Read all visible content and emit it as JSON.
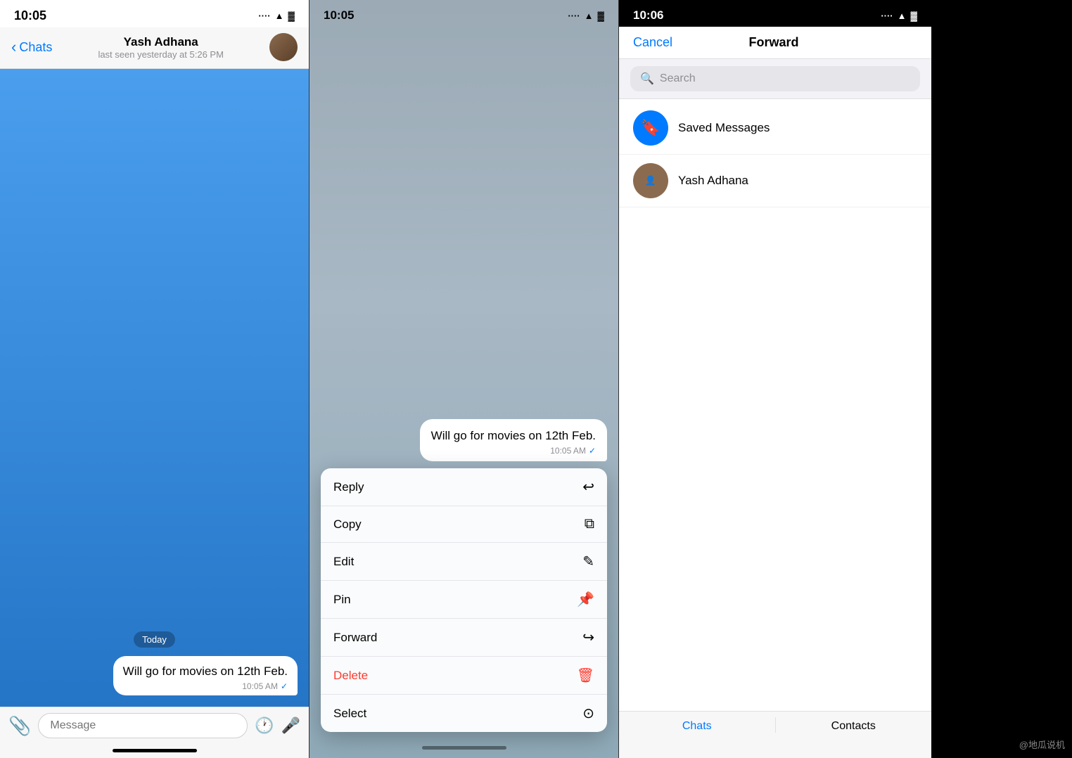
{
  "phone1": {
    "status_bar": {
      "time": "10:05",
      "signal": "....",
      "wifi": "WiFi",
      "battery": "🔋"
    },
    "header": {
      "back_label": "Chats",
      "contact_name": "Yash Adhana",
      "contact_status": "last seen yesterday at 5:26 PM"
    },
    "chat": {
      "date_label": "Today",
      "message_text": "Will go for movies on 12th Feb.",
      "message_time": "10:05 AM",
      "message_check": "✓"
    },
    "input": {
      "placeholder": "Message"
    }
  },
  "phone2": {
    "status_bar": {
      "time": "10:05",
      "signal": "....",
      "wifi": "WiFi",
      "battery": "🔋"
    },
    "message": {
      "text": "Will go for movies on 12th Feb.",
      "time": "10:05 AM",
      "check": "✓"
    },
    "context_menu": {
      "items": [
        {
          "label": "Reply",
          "icon": "↩",
          "style": "normal"
        },
        {
          "label": "Copy",
          "icon": "⧉",
          "style": "normal"
        },
        {
          "label": "Edit",
          "icon": "✎",
          "style": "normal"
        },
        {
          "label": "Pin",
          "icon": "📌",
          "style": "normal"
        },
        {
          "label": "Forward",
          "icon": "↪",
          "style": "normal"
        },
        {
          "label": "Delete",
          "icon": "🗑",
          "style": "delete"
        },
        {
          "label": "Select",
          "icon": "⊙",
          "style": "normal"
        }
      ]
    }
  },
  "phone3": {
    "status_bar": {
      "time": "10:06",
      "signal": "....",
      "wifi": "WiFi",
      "battery": "🔋"
    },
    "nav": {
      "cancel_label": "Cancel",
      "title": "Forward"
    },
    "search": {
      "placeholder": "Search"
    },
    "contacts": [
      {
        "name": "Saved Messages",
        "avatar_type": "saved",
        "avatar_icon": "🔖"
      },
      {
        "name": "Yash Adhana",
        "avatar_type": "yash",
        "avatar_icon": "Y"
      }
    ],
    "tabs": [
      {
        "label": "Chats",
        "active": true
      },
      {
        "label": "Contacts",
        "active": false
      }
    ]
  },
  "watermark": "@地瓜说机"
}
